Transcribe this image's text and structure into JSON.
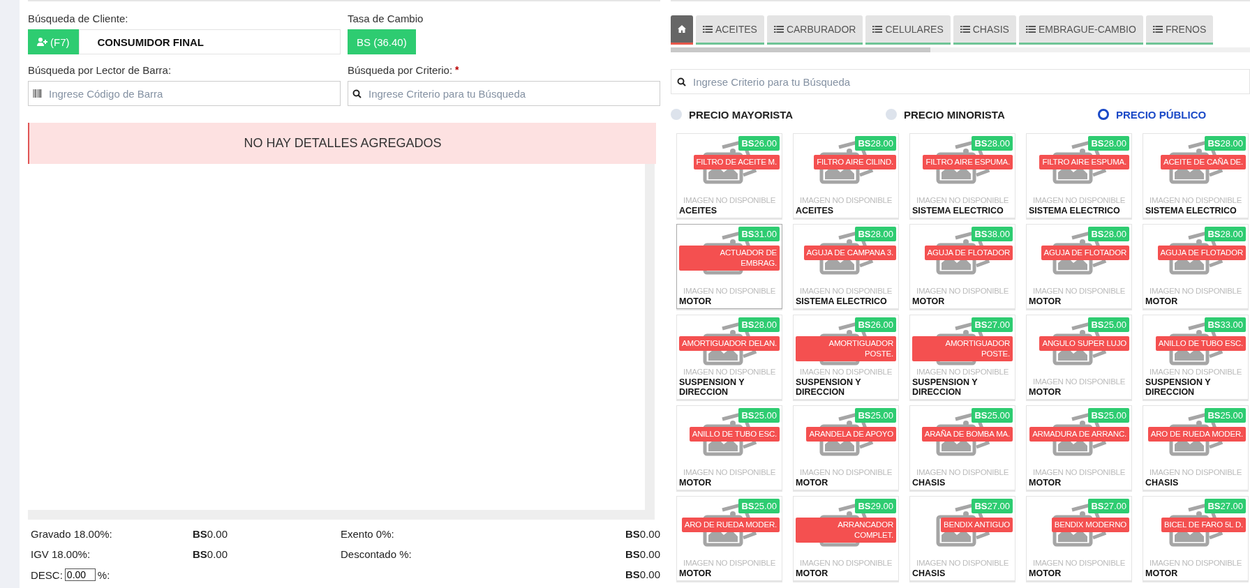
{
  "client_search": {
    "label": "Búsqueda de Cliente:",
    "button": "(F7)",
    "value": "CONSUMIDOR FINAL"
  },
  "exchange_rate": {
    "label": "Tasa de Cambio",
    "button": "BS (36.40)"
  },
  "barcode_search": {
    "label": "Búsqueda por Lector de Barra:",
    "placeholder": "Ingrese Código de Barra"
  },
  "criteria_search": {
    "label": "Búsqueda por Criterio:",
    "required_mark": "*",
    "placeholder": "Ingrese Criterio para tu Búsqueda"
  },
  "details_alert": "NO HAY DETALLES AGREGADOS",
  "summary": [
    {
      "kind": "pair",
      "items": [
        {
          "label": "Gravado 18.00%:",
          "value": "**BS**0.00"
        },
        {
          "label": "Exento 0%:",
          "value": "**BS**0.00"
        }
      ]
    },
    {
      "kind": "pair",
      "items": [
        {
          "label": "IGV 18.00%:",
          "value": "**BS**0.00"
        },
        {
          "label": "Descontado %:",
          "value": "**BS**0.00"
        }
      ]
    },
    {
      "kind": "discount",
      "label": "DESC:",
      "input": "0.00",
      "suffix": "%:",
      "value": "**BS**0.00"
    }
  ],
  "category_tabs": [
    {
      "kind": "home",
      "selected": true
    },
    {
      "kind": "category",
      "label": "ACEITES",
      "selected": false
    },
    {
      "kind": "category",
      "label": "CARBURADOR",
      "selected": false
    },
    {
      "kind": "category",
      "label": "CELULARES",
      "selected": false
    },
    {
      "kind": "category",
      "label": "CHASIS",
      "selected": false
    },
    {
      "kind": "category",
      "label": "EMBRAGUE-CAMBIO",
      "selected": false
    },
    {
      "kind": "category",
      "label": "FRENOS",
      "selected": false
    }
  ],
  "product_search": {
    "placeholder": "Ingrese Criterio para tu Búsqueda"
  },
  "price_options": [
    {
      "label": "PRECIO MAYORISTA",
      "selected": false
    },
    {
      "label": "PRECIO MINORISTA",
      "selected": false
    },
    {
      "label": "PRECIO PÚBLICO",
      "selected": true
    }
  ],
  "products": [
    {
      "price": "**BS**26.00",
      "name": "FILTRO DE ACEITE M.",
      "image_text": "IMAGEN NO DISPONIBLE",
      "category": "ACEITES",
      "selected": false
    },
    {
      "price": "**BS**28.00",
      "name": "FILTRO AIRE CILIND.",
      "image_text": "IMAGEN NO DISPONIBLE",
      "category": "ACEITES",
      "selected": false
    },
    {
      "price": "**BS**28.00",
      "name": "FILTRO AIRE ESPUMA.",
      "image_text": "IMAGEN NO DISPONIBLE",
      "category": "SISTEMA ELECTRICO",
      "selected": false
    },
    {
      "price": "**BS**28.00",
      "name": "FILTRO AIRE ESPUMA.",
      "image_text": "IMAGEN NO DISPONIBLE",
      "category": "SISTEMA ELECTRICO",
      "selected": false
    },
    {
      "price": "**BS**28.00",
      "name": "ACEITE DE CAÑA DE.",
      "image_text": "IMAGEN NO DISPONIBLE",
      "category": "SISTEMA ELECTRICO",
      "selected": false
    },
    {
      "price": "**BS**31.00",
      "name": "ACTUADOR DE EMBRAG.",
      "image_text": "IMAGEN NO DISPONIBLE",
      "category": "MOTOR",
      "selected": true
    },
    {
      "price": "**BS**28.00",
      "name": "AGUJA DE CAMPANA 3.",
      "image_text": "IMAGEN NO DISPONIBLE",
      "category": "SISTEMA ELECTRICO",
      "selected": false
    },
    {
      "price": "**BS**38.00",
      "name": "AGUJA DE FLOTADOR",
      "image_text": "IMAGEN NO DISPONIBLE",
      "category": "MOTOR",
      "selected": false
    },
    {
      "price": "**BS**28.00",
      "name": "AGUJA DE FLOTADOR",
      "image_text": "IMAGEN NO DISPONIBLE",
      "category": "MOTOR",
      "selected": false
    },
    {
      "price": "**BS**28.00",
      "name": "AGUJA DE FLOTADOR",
      "image_text": "IMAGEN NO DISPONIBLE",
      "category": "MOTOR",
      "selected": false
    },
    {
      "price": "**BS**28.00",
      "name": "AMORTIGUADOR DELAN.",
      "image_text": "IMAGEN NO DISPONIBLE",
      "category": "SUSPENSION Y DIRECCION",
      "selected": false
    },
    {
      "price": "**BS**26.00",
      "name": "AMORTIGUADOR POSTE.",
      "image_text": "IMAGEN NO DISPONIBLE",
      "category": "SUSPENSION Y DIRECCION",
      "selected": false
    },
    {
      "price": "**BS**27.00",
      "name": "AMORTIGUADOR POSTE.",
      "image_text": "IMAGEN NO DISPONIBLE",
      "category": "SUSPENSION Y DIRECCION",
      "selected": false
    },
    {
      "price": "**BS**25.00",
      "name": "ANGULO SUPER LUJO",
      "image_text": "IMAGEN NO DISPONIBLE",
      "category": "MOTOR",
      "selected": false
    },
    {
      "price": "**BS**33.00",
      "name": "ANILLO DE TUBO ESC.",
      "image_text": "IMAGEN NO DISPONIBLE",
      "category": "SUSPENSION Y DIRECCION",
      "selected": false
    },
    {
      "price": "**BS**25.00",
      "name": "ANILLO DE TUBO ESC.",
      "image_text": "IMAGEN NO DISPONIBLE",
      "category": "MOTOR",
      "selected": false
    },
    {
      "price": "**BS**25.00",
      "name": "ARANDELA DE APOYO",
      "image_text": "IMAGEN NO DISPONIBLE",
      "category": "MOTOR",
      "selected": false
    },
    {
      "price": "**BS**25.00",
      "name": "ARAÑA DE BOMBA MA.",
      "image_text": "IMAGEN NO DISPONIBLE",
      "category": "CHASIS",
      "selected": false
    },
    {
      "price": "**BS**25.00",
      "name": "ARMADURA DE ARRANC.",
      "image_text": "IMAGEN NO DISPONIBLE",
      "category": "MOTOR",
      "selected": false
    },
    {
      "price": "**BS**25.00",
      "name": "ARO DE RUEDA MODER.",
      "image_text": "IMAGEN NO DISPONIBLE",
      "category": "CHASIS",
      "selected": false
    },
    {
      "price": "**BS**25.00",
      "name": "ARO DE RUEDA MODER.",
      "image_text": "IMAGEN NO DISPONIBLE",
      "category": "MOTOR",
      "selected": false
    },
    {
      "price": "**BS**29.00",
      "name": "ARRANCADOR COMPLET.",
      "image_text": "IMAGEN NO DISPONIBLE",
      "category": "MOTOR",
      "selected": false
    },
    {
      "price": "**BS**27.00",
      "name": "BENDIX ANTIGUO",
      "image_text": "IMAGEN NO DISPONIBLE",
      "category": "CHASIS",
      "selected": false
    },
    {
      "price": "**BS**27.00",
      "name": "BENDIX MODERNO",
      "image_text": "IMAGEN NO DISPONIBLE",
      "category": "MOTOR",
      "selected": false
    },
    {
      "price": "**BS**27.00",
      "name": "BICEL DE FARO 5L D.",
      "image_text": "IMAGEN NO DISPONIBLE",
      "category": "MOTOR",
      "selected": false
    }
  ]
}
